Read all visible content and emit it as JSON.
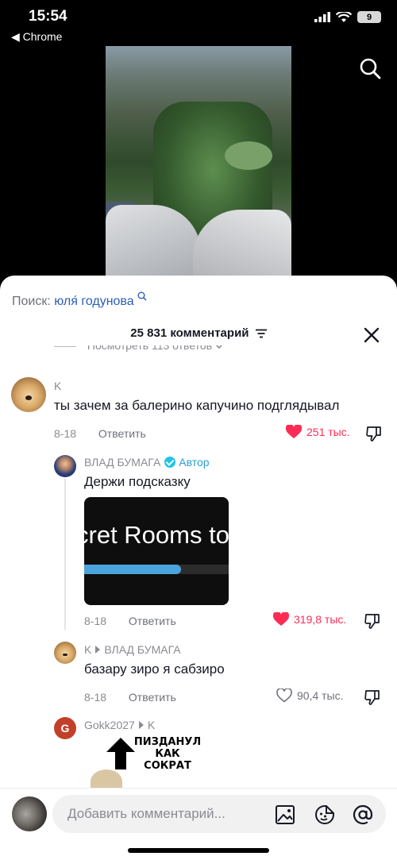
{
  "status_bar": {
    "time": "15:54",
    "back_label": "◀ Chrome",
    "battery": "9"
  },
  "search": {
    "label": "Поиск:",
    "query": "юля́ годунова"
  },
  "header": {
    "comment_count": "25 831 комментарий"
  },
  "partial_reply_link": "Посмотреть 113 ответов",
  "comments": [
    {
      "author": "K",
      "text": "ты зачем за балерино капучино подглядывал",
      "date": "8-18",
      "reply_label": "Ответить",
      "likes": "251 тыс.",
      "liked": true
    },
    {
      "author": "ВЛАД БУМАГА",
      "author_badge": "Автор",
      "text": "Держи подсказку",
      "gif_text": "cret Rooms to",
      "gif_progress": 0.67,
      "date": "8-18",
      "reply_label": "Ответить",
      "likes": "319,8 тыс.",
      "liked": true
    },
    {
      "author": "K",
      "reply_to": "ВЛАД БУМАГА",
      "text": "базару зиро я сабзиро",
      "date": "8-18",
      "reply_label": "Ответить",
      "likes": "90,4 тыс.",
      "liked": false
    },
    {
      "author": "Gokk2027",
      "avatar_letter": "G",
      "reply_to": "K",
      "meme_text": "ПИЗДАНУЛ КАК СОКРАТ"
    }
  ],
  "input": {
    "placeholder": "Добавить комментарий..."
  },
  "colors": {
    "like_red": "#fe2c55",
    "link_blue": "#2b5db9",
    "author_blue": "#2b9fd8"
  }
}
